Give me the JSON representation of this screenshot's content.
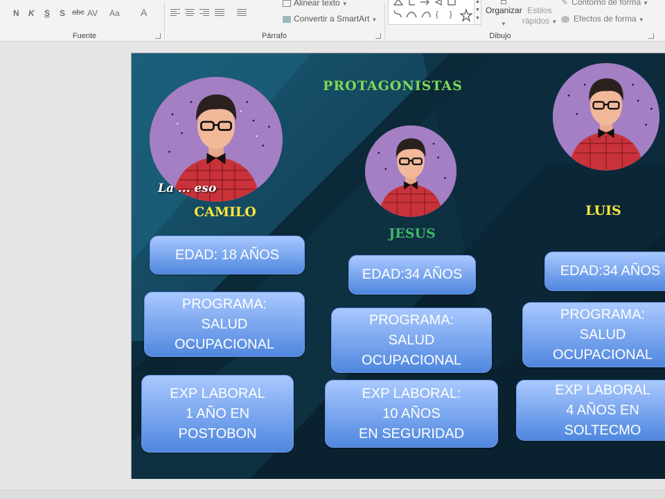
{
  "ribbon": {
    "fuente": {
      "label": "Fuente",
      "buttons": [
        "N",
        "K",
        "S",
        "S",
        "abc",
        "AV",
        "Aa",
        "A"
      ]
    },
    "parrafo": {
      "label": "Párrafo",
      "alinear_texto": "Alinear texto",
      "convertir_smartart": "Convertir a SmartArt"
    },
    "dibujo": {
      "label": "Dibujo",
      "organizar": "Organizar",
      "estilos_rapidos_1": "Estilos",
      "estilos_rapidos_2": "rápidos",
      "contorno_forma": "Contorno de forma",
      "efectos_forma": "Efectos de forma"
    }
  },
  "slide": {
    "title": "PROTAGONISTAS",
    "watermark": "La ... eso",
    "protagonists": [
      {
        "name": "CAMILO",
        "edad": "EDAD: 18 AÑOS",
        "programa": [
          "PROGRAMA:",
          "SALUD",
          "OCUPACIONAL"
        ],
        "experiencia": [
          "EXP LABORAL",
          "1 AÑO EN",
          "POSTOBON"
        ]
      },
      {
        "name": "JESUS",
        "edad": "EDAD:34 AÑOS",
        "programa": [
          "PROGRAMA:",
          "SALUD",
          "OCUPACIONAL"
        ],
        "experiencia": [
          "EXP LABORAL:",
          "10 AÑOS",
          "EN SEGURIDAD"
        ]
      },
      {
        "name": "LUIS",
        "edad": "EDAD:34 AÑOS",
        "programa": [
          "PROGRAMA:",
          "SALUD",
          "OCUPACIONAL"
        ],
        "experiencia": [
          "EXP LABORAL",
          "4 AÑOS  EN",
          "SOLTECMO"
        ]
      }
    ]
  },
  "colors": {
    "slide_bg": "#0c2d3e",
    "title_green": "#7ed957",
    "name_yellow": "#ffe63b",
    "name_green": "#3fb66b",
    "card_top": "#a9c8ff",
    "card_bottom": "#4f87df",
    "avatar_purple": "#a47fc4"
  },
  "icons": [
    "shapes-gallery-icon",
    "organize-icon",
    "quick-styles-icon",
    "shape-outline-icon",
    "shape-effects-icon",
    "dialog-launcher-icon"
  ]
}
